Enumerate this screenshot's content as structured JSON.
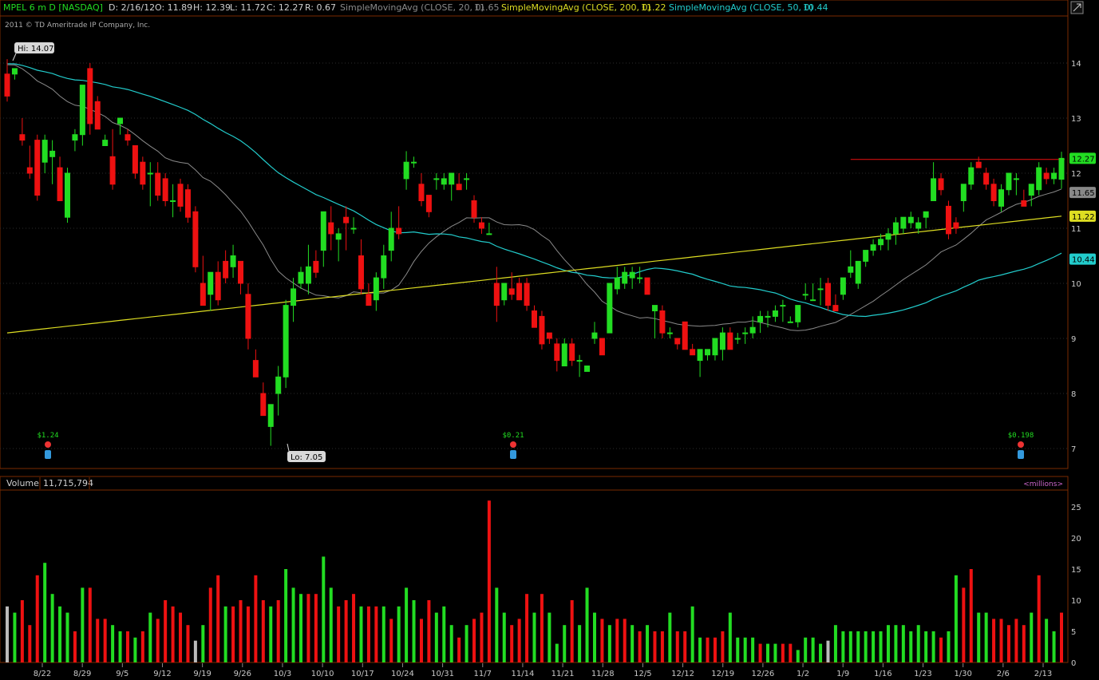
{
  "header": {
    "symbol": "MPEL 6 m D [NASDAQ]",
    "date": "D: 2/16/12",
    "open": "O: 11.89",
    "high": "H: 12.39",
    "low": "L: 11.72",
    "close": "C: 12.27",
    "range": "R: 0.67",
    "sma20_label": "SimpleMovingAvg (CLOSE, 20, 0)",
    "sma20_value": "11.65",
    "sma200_label": "SimpleMovingAvg (CLOSE, 200, 0)",
    "sma200_value": "11.22",
    "sma50_label": "SimpleMovingAvg (CLOSE, 50, 0)",
    "sma50_value": "10.44",
    "copyright": "2011 © TD Ameritrade IP Company, Inc."
  },
  "colors": {
    "up": "#22dd22",
    "down": "#ee1111",
    "sma20": "#8a8a8a",
    "sma50": "#22cccc",
    "sma200": "#dddd22",
    "resistance": "#ee1111",
    "grid": "#2b2b2b",
    "panel_border": "#7a2a00"
  },
  "annotations": {
    "hi_label": "Hi: 14.07",
    "lo_label": "Lo: 7.05",
    "dividends": [
      "$1.24",
      "$0.21",
      "$0.198"
    ]
  },
  "price_badges": {
    "last": "12.27",
    "sma20": "11.65",
    "sma200": "11.22",
    "sma50": "10.44"
  },
  "volume_panel": {
    "title": "Volume",
    "value": "11,715,794",
    "units": "<millions>"
  },
  "chart_data": {
    "type": "candlestick",
    "price_axis": {
      "min": 7,
      "max": 14,
      "ticks": [
        7,
        8,
        9,
        10,
        11,
        12,
        13,
        14
      ]
    },
    "volume_axis": {
      "min": 0,
      "max": 25,
      "ticks": [
        0,
        5,
        10,
        15,
        20,
        25
      ],
      "units": "millions"
    },
    "date_labels": [
      "8/22",
      "8/29",
      "9/5",
      "9/12",
      "9/19",
      "9/26",
      "10/3",
      "10/10",
      "10/17",
      "10/24",
      "10/31",
      "11/7",
      "11/14",
      "11/21",
      "11/28",
      "12/5",
      "12/12",
      "12/19",
      "12/26",
      "1/2",
      "1/9",
      "1/16",
      "1/23",
      "1/30",
      "2/6",
      "2/13"
    ],
    "resistance_level": 12.25,
    "hi": 14.07,
    "lo": 7.05,
    "candles": [
      [
        13.8,
        14.07,
        13.3,
        13.4
      ],
      [
        13.8,
        13.9,
        13.7,
        13.9
      ],
      [
        12.7,
        13.0,
        12.5,
        12.6
      ],
      [
        12.1,
        12.5,
        11.9,
        12.0
      ],
      [
        12.6,
        12.7,
        11.5,
        11.6
      ],
      [
        12.2,
        12.7,
        12.0,
        12.6
      ],
      [
        12.3,
        12.6,
        11.8,
        12.4
      ],
      [
        12.1,
        12.3,
        11.5,
        11.5
      ],
      [
        11.2,
        12.1,
        11.1,
        12.0
      ],
      [
        12.6,
        12.8,
        12.4,
        12.7
      ],
      [
        12.7,
        13.3,
        12.5,
        13.6
      ],
      [
        13.9,
        14.0,
        12.7,
        12.9
      ],
      [
        13.3,
        13.4,
        12.8,
        12.8
      ],
      [
        12.5,
        12.7,
        12.5,
        12.6
      ],
      [
        12.3,
        12.8,
        11.7,
        11.8
      ],
      [
        12.9,
        13.0,
        12.7,
        13.0
      ],
      [
        12.7,
        12.8,
        12.5,
        12.6
      ],
      [
        12.5,
        12.5,
        11.9,
        12.0
      ],
      [
        12.2,
        12.3,
        11.7,
        11.8
      ],
      [
        12.0,
        12.2,
        11.4,
        12.0
      ],
      [
        12.0,
        12.2,
        11.5,
        11.6
      ],
      [
        11.9,
        12.0,
        11.4,
        11.5
      ],
      [
        11.5,
        11.8,
        11.2,
        11.5
      ],
      [
        11.8,
        11.9,
        11.3,
        11.4
      ],
      [
        11.7,
        11.8,
        11.1,
        11.2
      ],
      [
        11.3,
        11.4,
        10.2,
        10.3
      ],
      [
        10.0,
        10.5,
        9.6,
        9.6
      ],
      [
        9.8,
        10.2,
        9.5,
        10.2
      ],
      [
        10.2,
        10.4,
        9.6,
        9.7
      ],
      [
        10.4,
        10.6,
        10.0,
        10.1
      ],
      [
        10.3,
        10.7,
        10.1,
        10.5
      ],
      [
        10.4,
        10.4,
        9.8,
        10.0
      ],
      [
        9.8,
        10.0,
        8.8,
        9.0
      ],
      [
        8.6,
        8.8,
        8.3,
        8.3
      ],
      [
        8.0,
        8.2,
        7.6,
        7.6
      ],
      [
        7.4,
        7.7,
        7.05,
        7.8
      ],
      [
        8.0,
        8.5,
        7.6,
        8.3
      ],
      [
        8.3,
        9.7,
        8.1,
        9.6
      ],
      [
        9.6,
        10.1,
        9.3,
        9.9
      ],
      [
        10.0,
        10.3,
        9.9,
        10.2
      ],
      [
        10.0,
        10.7,
        9.8,
        10.3
      ],
      [
        10.4,
        10.6,
        10.1,
        10.2
      ],
      [
        10.6,
        11.3,
        10.3,
        11.3
      ],
      [
        11.1,
        11.4,
        10.6,
        10.9
      ],
      [
        10.8,
        11.0,
        10.4,
        10.9
      ],
      [
        11.2,
        11.4,
        10.6,
        11.1
      ],
      [
        11.0,
        11.2,
        10.9,
        11.0
      ],
      [
        10.5,
        10.8,
        9.8,
        9.9
      ],
      [
        9.8,
        10.0,
        9.6,
        9.6
      ],
      [
        9.7,
        10.2,
        9.5,
        10.1
      ],
      [
        10.1,
        10.7,
        9.9,
        10.5
      ],
      [
        10.6,
        11.3,
        10.4,
        11.0
      ],
      [
        11.0,
        11.4,
        10.8,
        10.9
      ],
      [
        11.9,
        12.4,
        11.7,
        12.2
      ],
      [
        12.2,
        12.3,
        12.1,
        12.2
      ],
      [
        11.8,
        12.0,
        11.4,
        11.5
      ],
      [
        11.6,
        11.6,
        11.2,
        11.3
      ],
      [
        11.9,
        12.0,
        11.7,
        11.9
      ],
      [
        11.8,
        12.0,
        11.7,
        11.9
      ],
      [
        11.8,
        12.0,
        11.5,
        12.0
      ],
      [
        11.8,
        12.0,
        11.7,
        11.7
      ],
      [
        11.9,
        12.0,
        11.7,
        11.9
      ],
      [
        11.5,
        11.6,
        11.1,
        11.2
      ],
      [
        11.1,
        11.2,
        10.9,
        11.0
      ],
      [
        10.9,
        11.1,
        10.9,
        10.9
      ],
      [
        10.0,
        10.3,
        9.3,
        9.6
      ],
      [
        9.7,
        10.0,
        9.6,
        10.0
      ],
      [
        9.9,
        10.2,
        9.7,
        9.8
      ],
      [
        10.0,
        10.1,
        9.7,
        9.7
      ],
      [
        10.0,
        10.1,
        9.5,
        9.6
      ],
      [
        9.5,
        9.6,
        9.2,
        9.2
      ],
      [
        9.4,
        9.5,
        8.8,
        8.9
      ],
      [
        9.1,
        9.1,
        8.9,
        9.0
      ],
      [
        8.9,
        9.0,
        8.4,
        8.6
      ],
      [
        8.5,
        9.0,
        8.5,
        8.9
      ],
      [
        8.9,
        9.0,
        8.5,
        8.6
      ],
      [
        8.6,
        8.7,
        8.3,
        8.6
      ],
      [
        8.4,
        8.5,
        8.4,
        8.5
      ],
      [
        9.0,
        9.3,
        8.9,
        9.1
      ],
      [
        9.0,
        9.0,
        8.7,
        8.7
      ],
      [
        9.1,
        10.0,
        9.1,
        10.0
      ],
      [
        9.9,
        10.3,
        9.8,
        10.1
      ],
      [
        10.0,
        10.3,
        9.9,
        10.2
      ],
      [
        10.1,
        10.3,
        9.9,
        10.2
      ],
      [
        10.1,
        10.3,
        10.0,
        10.1
      ],
      [
        10.1,
        10.1,
        9.8,
        9.8
      ],
      [
        9.5,
        9.6,
        9.0,
        9.6
      ],
      [
        9.5,
        9.6,
        9.0,
        9.1
      ],
      [
        9.1,
        9.2,
        9.0,
        9.1
      ],
      [
        9.0,
        9.0,
        8.8,
        8.9
      ],
      [
        9.3,
        9.3,
        8.8,
        8.8
      ],
      [
        8.8,
        8.9,
        8.7,
        8.7
      ],
      [
        8.6,
        8.8,
        8.3,
        8.8
      ],
      [
        8.7,
        8.8,
        8.6,
        8.8
      ],
      [
        8.7,
        9.0,
        8.6,
        9.0
      ],
      [
        8.8,
        9.2,
        8.6,
        9.1
      ],
      [
        9.1,
        9.2,
        8.9,
        8.8
      ],
      [
        9.0,
        9.1,
        8.9,
        9.0
      ],
      [
        9.1,
        9.2,
        8.9,
        9.1
      ],
      [
        9.1,
        9.4,
        9.0,
        9.2
      ],
      [
        9.3,
        9.5,
        9.1,
        9.4
      ],
      [
        9.4,
        9.5,
        9.2,
        9.4
      ],
      [
        9.4,
        9.6,
        9.3,
        9.5
      ],
      [
        9.6,
        9.7,
        9.3,
        9.6
      ],
      [
        9.3,
        9.4,
        9.3,
        9.3
      ],
      [
        9.3,
        9.6,
        9.2,
        9.6
      ],
      [
        9.8,
        10.0,
        9.7,
        9.8
      ],
      [
        9.7,
        10.0,
        9.7,
        9.7
      ],
      [
        9.9,
        10.1,
        9.6,
        9.9
      ],
      [
        10.0,
        10.1,
        9.5,
        9.6
      ],
      [
        9.6,
        9.8,
        9.5,
        9.5
      ],
      [
        9.8,
        10.1,
        9.7,
        10.1
      ],
      [
        10.2,
        10.6,
        10.1,
        10.3
      ],
      [
        10.0,
        10.4,
        9.9,
        10.4
      ],
      [
        10.4,
        10.6,
        10.3,
        10.6
      ],
      [
        10.6,
        10.8,
        10.5,
        10.7
      ],
      [
        10.7,
        10.9,
        10.6,
        10.8
      ],
      [
        10.8,
        11.0,
        10.6,
        10.9
      ],
      [
        10.9,
        11.2,
        10.7,
        11.1
      ],
      [
        11.0,
        11.2,
        10.9,
        11.2
      ],
      [
        11.1,
        11.3,
        11.0,
        11.2
      ],
      [
        11.0,
        11.2,
        10.9,
        11.1
      ],
      [
        11.2,
        11.3,
        11.0,
        11.3
      ],
      [
        11.5,
        12.2,
        11.5,
        11.9
      ],
      [
        11.9,
        12.0,
        11.6,
        11.7
      ],
      [
        11.4,
        11.5,
        10.8,
        10.9
      ],
      [
        11.1,
        11.2,
        10.9,
        11.0
      ],
      [
        11.5,
        11.8,
        11.3,
        11.8
      ],
      [
        11.8,
        12.2,
        11.7,
        12.1
      ],
      [
        12.2,
        12.3,
        12.1,
        12.1
      ],
      [
        12.0,
        12.1,
        11.7,
        11.8
      ],
      [
        11.8,
        11.9,
        11.4,
        11.5
      ],
      [
        11.4,
        11.8,
        11.3,
        11.7
      ],
      [
        11.7,
        12.0,
        11.6,
        12.0
      ],
      [
        11.9,
        12.0,
        11.6,
        11.9
      ],
      [
        11.5,
        11.7,
        11.4,
        11.4
      ],
      [
        11.6,
        11.8,
        11.4,
        11.8
      ],
      [
        11.7,
        12.2,
        11.6,
        12.1
      ],
      [
        12.0,
        12.1,
        11.8,
        11.9
      ],
      [
        11.9,
        12.1,
        11.8,
        12.0
      ],
      [
        11.89,
        12.39,
        11.72,
        12.27
      ]
    ],
    "volume_millions": [
      [
        9,
        "#bbbbbb"
      ],
      [
        8,
        "g"
      ],
      [
        10,
        "r"
      ],
      [
        6,
        "r"
      ],
      [
        14,
        "r"
      ],
      [
        16,
        "g"
      ],
      [
        11,
        "g"
      ],
      [
        9,
        "g"
      ],
      [
        8,
        "g"
      ],
      [
        5,
        "r"
      ],
      [
        12,
        "g"
      ],
      [
        12,
        "r"
      ],
      [
        7,
        "r"
      ],
      [
        7,
        "r"
      ],
      [
        6,
        "g"
      ],
      [
        5,
        "g"
      ],
      [
        5,
        "r"
      ],
      [
        4,
        "g"
      ],
      [
        5,
        "r"
      ],
      [
        8,
        "g"
      ],
      [
        7,
        "r"
      ],
      [
        10,
        "r"
      ],
      [
        9,
        "r"
      ],
      [
        8,
        "r"
      ],
      [
        6,
        "r"
      ],
      [
        3.5,
        "#bbbbbb"
      ],
      [
        6,
        "g"
      ],
      [
        12,
        "r"
      ],
      [
        14,
        "r"
      ],
      [
        9,
        "g"
      ],
      [
        9,
        "r"
      ],
      [
        10,
        "r"
      ],
      [
        9,
        "r"
      ],
      [
        14,
        "r"
      ],
      [
        10,
        "r"
      ],
      [
        9,
        "g"
      ],
      [
        10,
        "r"
      ],
      [
        15,
        "g"
      ],
      [
        12,
        "g"
      ],
      [
        11,
        "g"
      ],
      [
        11,
        "r"
      ],
      [
        11,
        "r"
      ],
      [
        17,
        "g"
      ],
      [
        12,
        "g"
      ],
      [
        9,
        "r"
      ],
      [
        10,
        "r"
      ],
      [
        11,
        "r"
      ],
      [
        9,
        "g"
      ],
      [
        9,
        "r"
      ],
      [
        9,
        "r"
      ],
      [
        9,
        "g"
      ],
      [
        7,
        "r"
      ],
      [
        9,
        "g"
      ],
      [
        12,
        "g"
      ],
      [
        10,
        "g"
      ],
      [
        7,
        "r"
      ],
      [
        10,
        "r"
      ],
      [
        8,
        "g"
      ],
      [
        9,
        "g"
      ],
      [
        6,
        "g"
      ],
      [
        4,
        "r"
      ],
      [
        6,
        "g"
      ],
      [
        7,
        "r"
      ],
      [
        8,
        "r"
      ],
      [
        26,
        "r"
      ],
      [
        12,
        "g"
      ],
      [
        8,
        "g"
      ],
      [
        6,
        "r"
      ],
      [
        7,
        "r"
      ],
      [
        11,
        "r"
      ],
      [
        8,
        "g"
      ],
      [
        11,
        "r"
      ],
      [
        8,
        "g"
      ],
      [
        3,
        "g"
      ],
      [
        6,
        "g"
      ],
      [
        10,
        "r"
      ],
      [
        6,
        "g"
      ],
      [
        12,
        "g"
      ],
      [
        8,
        "g"
      ],
      [
        7,
        "r"
      ],
      [
        6,
        "g"
      ],
      [
        7,
        "r"
      ],
      [
        7,
        "r"
      ],
      [
        6,
        "g"
      ],
      [
        5,
        "r"
      ],
      [
        6,
        "g"
      ],
      [
        5,
        "r"
      ],
      [
        5,
        "r"
      ],
      [
        8,
        "g"
      ],
      [
        5,
        "r"
      ],
      [
        5,
        "r"
      ],
      [
        9,
        "g"
      ],
      [
        4,
        "g"
      ],
      [
        4,
        "r"
      ],
      [
        4,
        "r"
      ],
      [
        5,
        "r"
      ],
      [
        8,
        "g"
      ],
      [
        4,
        "g"
      ],
      [
        4,
        "g"
      ],
      [
        4,
        "g"
      ],
      [
        3,
        "r"
      ],
      [
        3,
        "g"
      ],
      [
        3,
        "g"
      ],
      [
        3,
        "r"
      ],
      [
        3,
        "r"
      ],
      [
        2,
        "g"
      ],
      [
        4,
        "g"
      ],
      [
        4,
        "g"
      ],
      [
        3,
        "g"
      ],
      [
        3.5,
        "#bbbbbb"
      ],
      [
        6,
        "g"
      ],
      [
        5,
        "g"
      ],
      [
        5,
        "g"
      ],
      [
        5,
        "g"
      ],
      [
        5,
        "g"
      ],
      [
        5,
        "g"
      ],
      [
        5,
        "g"
      ],
      [
        6,
        "g"
      ],
      [
        6,
        "g"
      ],
      [
        6,
        "g"
      ],
      [
        5,
        "g"
      ],
      [
        6,
        "g"
      ],
      [
        5,
        "g"
      ],
      [
        5,
        "g"
      ],
      [
        4,
        "r"
      ],
      [
        5,
        "g"
      ],
      [
        14,
        "g"
      ],
      [
        12,
        "r"
      ],
      [
        15,
        "r"
      ],
      [
        8,
        "g"
      ],
      [
        8,
        "g"
      ],
      [
        7,
        "r"
      ],
      [
        7,
        "r"
      ],
      [
        6,
        "r"
      ],
      [
        7,
        "r"
      ],
      [
        6,
        "r"
      ],
      [
        8,
        "g"
      ],
      [
        14,
        "r"
      ],
      [
        7,
        "g"
      ],
      [
        5,
        "g"
      ],
      [
        8,
        "r"
      ],
      [
        9,
        "g"
      ],
      [
        8,
        "g"
      ],
      [
        8,
        "g"
      ],
      [
        12,
        "g"
      ]
    ]
  }
}
